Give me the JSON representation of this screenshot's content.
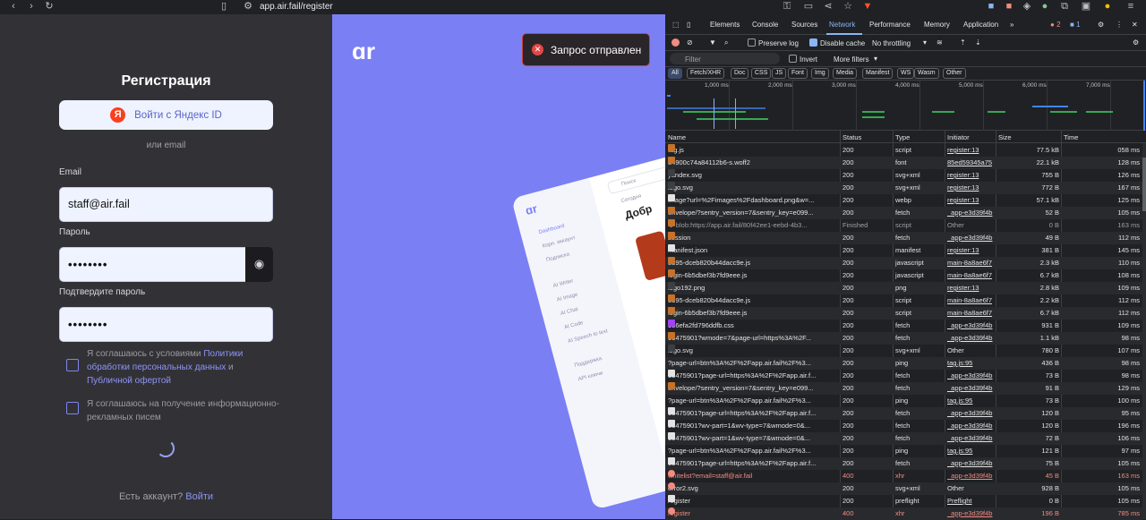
{
  "browser": {
    "url": "app.air.fail/register",
    "icons": [
      "back-icon",
      "forward-icon",
      "reload-icon",
      "bookmark-icon",
      "site-info-icon",
      "key-icon",
      "cast-icon",
      "share-icon",
      "star-icon",
      "brave-shield-icon",
      "brave-rewards-icon",
      "extension-icon",
      "profile-icon",
      "menu-icon"
    ]
  },
  "register": {
    "title": "Регистрация",
    "yandex_button": "Войти с Яндекс ID",
    "yandex_logo": "Я",
    "or_email": "или email",
    "email_label": "Email",
    "email_value": "staff@air.fail",
    "password_label": "Пароль",
    "password_value": "••••••••",
    "confirm_label": "Подтвердите пароль",
    "confirm_value": "••••••••",
    "consent1_pre": "Я соглашаюсь с условиями ",
    "consent1_link1": "Политики обработки персональных данных",
    "consent1_mid": " и ",
    "consent1_link2": "Публичной офертой",
    "consent2": "Я соглашаюсь на получение информационно-рекламных писем",
    "have_account": "Есть аккаунт? ",
    "login_link": "Войти"
  },
  "promo": {
    "toast": "Запрос отправлен",
    "menu": [
      "Dashboard",
      "Корп. аккаунт",
      "Подписка",
      "AI Writer",
      "AI Image",
      "AI Chat",
      "AI Code",
      "AI Speech to text",
      "Поддержка",
      "API ключи"
    ],
    "search": "Поиск",
    "greeting": "Добр",
    "today": "Сегодня"
  },
  "devtools": {
    "tabs": [
      "Elements",
      "Console",
      "Sources",
      "Network",
      "Performance",
      "Memory",
      "Application"
    ],
    "active_tab": "Network",
    "badges": {
      "errors": "2",
      "messages": "1"
    },
    "toolbar": {
      "preserve_log": "Preserve log",
      "disable_cache": "Disable cache",
      "throttling": "No throttling"
    },
    "filter_placeholder": "Filter",
    "invert": "Invert",
    "more_filters": "More filters",
    "filter_chips": [
      "All",
      "Fetch/XHR",
      "Doc",
      "CSS",
      "JS",
      "Font",
      "Img",
      "Media",
      "Manifest",
      "WS",
      "Wasm",
      "Other"
    ],
    "timeline_labels": [
      "1,000 ms",
      "2,000 ms",
      "3,000 ms",
      "4,000 ms",
      "5,000 ms",
      "6,000 ms",
      "7,000 ms"
    ],
    "columns": [
      "Name",
      "Status",
      "Type",
      "Initiator",
      "Size",
      "Time"
    ],
    "rows": [
      {
        "name": "tag.js",
        "status": "200",
        "type": "script",
        "initiator": "register:13",
        "size": "77.5 kB",
        "time": "058 ms",
        "icon": "script-icon"
      },
      {
        "name": "34900c74a84112b6-s.woff2",
        "status": "200",
        "type": "font",
        "initiator": "85ed59345a75",
        "size": "22.1 kB",
        "time": "128 ms",
        "icon": "font-icon"
      },
      {
        "name": "yandex.svg",
        "status": "200",
        "type": "svg+xml",
        "initiator": "register:13",
        "size": "755 B",
        "time": "126 ms",
        "icon": "image-icon"
      },
      {
        "name": "logo.svg",
        "status": "200",
        "type": "svg+xml",
        "initiator": "register:13",
        "size": "772 B",
        "time": "167 ms",
        "icon": "image-icon"
      },
      {
        "name": "image?url=%2Fimages%2Fdashboard.png&w=...",
        "status": "200",
        "type": "webp",
        "initiator": "register:13",
        "size": "57.1 kB",
        "time": "125 ms",
        "icon": "document-icon"
      },
      {
        "name": "envelope/?sentry_version=7&sentry_key=e099...",
        "status": "200",
        "type": "fetch",
        "initiator": "_app-e3d39f4b",
        "size": "52 B",
        "time": "105 ms",
        "icon": "fetch-icon"
      },
      {
        "name": "⚙ blob:https://app.air.fail/80f42ee1-eebd-4b3...",
        "status": "Finished",
        "type": "script",
        "initiator": "Other",
        "size": "0 B",
        "time": "163 ms",
        "icon": "script-icon",
        "muted": true
      },
      {
        "name": "session",
        "status": "200",
        "type": "fetch",
        "initiator": "_app-e3d39f4b",
        "size": "49 B",
        "time": "112 ms",
        "icon": "fetch-icon"
      },
      {
        "name": "manifest.json",
        "status": "200",
        "type": "manifest",
        "initiator": "register:13",
        "size": "381 B",
        "time": "145 ms",
        "icon": "document-icon"
      },
      {
        "name": "5395-dceb820b44dacc9e.js",
        "status": "200",
        "type": "javascript",
        "initiator": "main-8a8ae6f7",
        "size": "2.3 kB",
        "time": "110 ms",
        "icon": "script-icon"
      },
      {
        "name": "login-6b5dbef3b7fd9eee.js",
        "status": "200",
        "type": "javascript",
        "initiator": "main-8a8ae6f7",
        "size": "6.7 kB",
        "time": "108 ms",
        "icon": "script-icon"
      },
      {
        "name": "logo192.png",
        "status": "200",
        "type": "png",
        "initiator": "register:13",
        "size": "2.8 kB",
        "time": "109 ms",
        "icon": "image-icon"
      },
      {
        "name": "5395-dceb820b44dacc9e.js",
        "status": "200",
        "type": "script",
        "initiator": "main-8a8ae6f7",
        "size": "2.2 kB",
        "time": "112 ms",
        "icon": "script-icon"
      },
      {
        "name": "login-6b5dbef3b7fd9eee.js",
        "status": "200",
        "type": "script",
        "initiator": "main-8a8ae6f7",
        "size": "6.7 kB",
        "time": "112 ms",
        "icon": "script-icon"
      },
      {
        "name": "956efa2fd796ddfb.css",
        "status": "200",
        "type": "fetch",
        "initiator": "_app-e3d39f4b",
        "size": "931 B",
        "time": "109 ms",
        "icon": "stylesheet-icon"
      },
      {
        "name": "93475901?wmode=7&page-url=https%3A%2F...",
        "status": "200",
        "type": "fetch",
        "initiator": "_app-e3d39f4b",
        "size": "1.1 kB",
        "time": "98 ms",
        "icon": "fetch-icon"
      },
      {
        "name": "logo.svg",
        "status": "200",
        "type": "svg+xml",
        "initiator": "Other",
        "size": "780 B",
        "time": "107 ms",
        "icon": "image-icon"
      },
      {
        "name": "?page-url=btn%3A%2F%2Fapp.air.fail%2F%3...",
        "status": "200",
        "type": "ping",
        "initiator": "tag.js:95",
        "size": "436 B",
        "time": "98 ms",
        "icon": "ping-icon"
      },
      {
        "name": "93475901?page-url=https%3A%2F%2Fapp.air.f...",
        "status": "200",
        "type": "fetch",
        "initiator": "_app-e3d39f4b",
        "size": "73 B",
        "time": "98 ms",
        "icon": "document-icon"
      },
      {
        "name": "envelope/?sentry_version=7&sentry_key=e099...",
        "status": "200",
        "type": "fetch",
        "initiator": "_app-e3d39f4b",
        "size": "91 B",
        "time": "129 ms",
        "icon": "fetch-icon"
      },
      {
        "name": "?page-url=btn%3A%2F%2Fapp.air.fail%2F%3...",
        "status": "200",
        "type": "ping",
        "initiator": "tag.js:95",
        "size": "73 B",
        "time": "100 ms",
        "icon": "ping-icon"
      },
      {
        "name": "93475901?page-url=https%3A%2F%2Fapp.air.f...",
        "status": "200",
        "type": "fetch",
        "initiator": "_app-e3d39f4b",
        "size": "120 B",
        "time": "95 ms",
        "icon": "document-icon"
      },
      {
        "name": "93475901?wv-part=1&wv-type=7&wmode=0&...",
        "status": "200",
        "type": "fetch",
        "initiator": "_app-e3d39f4b",
        "size": "120 B",
        "time": "196 ms",
        "icon": "document-icon"
      },
      {
        "name": "93475901?wv-part=1&wv-type=7&wmode=0&...",
        "status": "200",
        "type": "fetch",
        "initiator": "_app-e3d39f4b",
        "size": "72 B",
        "time": "106 ms",
        "icon": "document-icon"
      },
      {
        "name": "?page-url=btn%3A%2F%2Fapp.air.fail%2F%3...",
        "status": "200",
        "type": "ping",
        "initiator": "tag.js:95",
        "size": "121 B",
        "time": "97 ms",
        "icon": "ping-icon"
      },
      {
        "name": "93475901?page-url=https%3A%2F%2Fapp.air.f...",
        "status": "200",
        "type": "fetch",
        "initiator": "_app-e3d39f4b",
        "size": "75 B",
        "time": "105 ms",
        "icon": "document-icon"
      },
      {
        "name": "whitelist?email=staff@air.fail",
        "status": "400",
        "type": "xhr",
        "initiator": "_app-e3d39f4b",
        "size": "45 B",
        "time": "163 ms",
        "icon": "error-icon",
        "error": true
      },
      {
        "name": "error2.svg",
        "status": "200",
        "type": "svg+xml",
        "initiator": "Other",
        "size": "928 B",
        "time": "105 ms",
        "icon": "error-icon"
      },
      {
        "name": "register",
        "status": "200",
        "type": "preflight",
        "initiator": "Preflight",
        "size": "0 B",
        "time": "105 ms",
        "icon": "document-icon"
      },
      {
        "name": "register",
        "status": "400",
        "type": "xhr",
        "initiator": "_app-e3d39f4b",
        "size": "196 B",
        "time": "785 ms",
        "icon": "error-icon",
        "error": true
      }
    ]
  },
  "colors": {
    "accent": "#7b7ff4",
    "error": "#f28b82",
    "link": "#8ab4f8"
  }
}
